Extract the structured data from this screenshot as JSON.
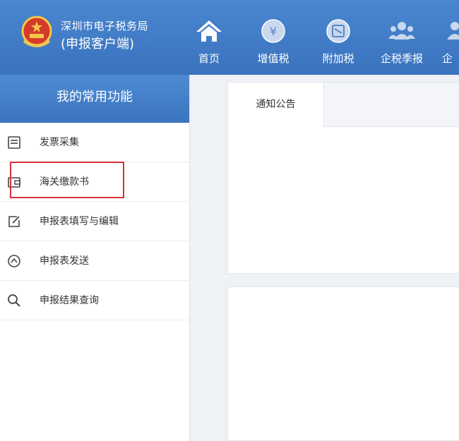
{
  "header": {
    "org_name": "深圳市电子税务局",
    "client_name": "(申报客户端)",
    "logo_icon": "national-emblem-icon",
    "nav": [
      {
        "label": "首页",
        "icon": "home-icon"
      },
      {
        "label": "增值税",
        "icon": "yuan-coin-icon"
      },
      {
        "label": "附加税",
        "icon": "tax-coin-icon"
      },
      {
        "label": "企税季报",
        "icon": "users-icon"
      },
      {
        "label": "企",
        "icon": "users-icon"
      }
    ]
  },
  "sidebar": {
    "title": "我的常用功能",
    "items": [
      {
        "label": "发票采集",
        "icon": "invoice-icon"
      },
      {
        "label": "海关缴款书",
        "icon": "wallet-icon"
      },
      {
        "label": "申报表填写与编辑",
        "icon": "edit-icon"
      },
      {
        "label": "申报表发送",
        "icon": "send-icon"
      },
      {
        "label": "申报结果查询",
        "icon": "search-icon"
      }
    ]
  },
  "main": {
    "tabs": [
      {
        "label": "通知公告"
      }
    ]
  },
  "colors": {
    "header_blue": "#3a73be",
    "highlight_red": "#d4343c"
  }
}
